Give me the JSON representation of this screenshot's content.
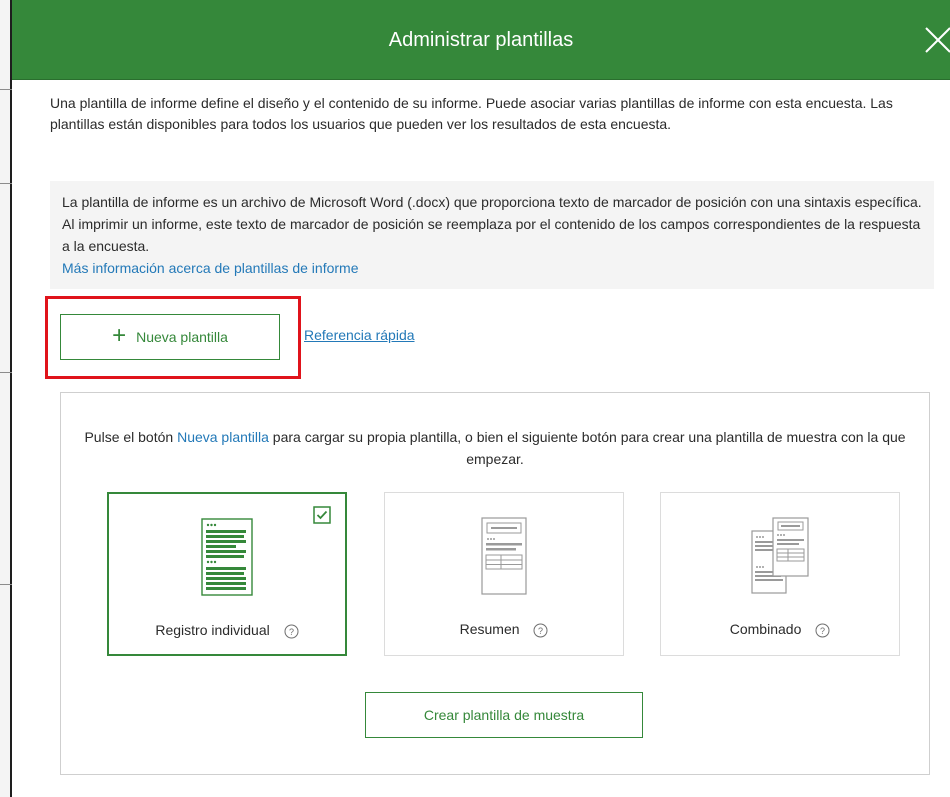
{
  "dialog": {
    "title": "Administrar plantillas",
    "intro": "Una plantilla de informe define el diseño y el contenido de su informe. Puede asociar varias plantillas de informe con esta encuesta. Las plantillas están disponibles para todos los usuarios que pueden ver los resultados de esta encuesta.",
    "info_text": "La plantilla de informe es un archivo de Microsoft Word (.docx) que proporciona texto de marcador de posición con una sintaxis específica. Al imprimir un informe, este texto de marcador de posición se reemplaza por el contenido de los campos correspondientes de la respuesta a la encuesta.",
    "info_link": "Más información acerca de plantillas de informe"
  },
  "actions": {
    "new_template_label": "Nueva plantilla",
    "new_template_icon": "plus-icon",
    "quick_reference_label": "Referencia rápida"
  },
  "samples": {
    "instruction_before": "Pulse el botón ",
    "instruction_link": "Nueva plantilla",
    "instruction_after": " para cargar su propia plantilla, o bien el siguiente botón para crear una plantilla de muestra con la que empezar.",
    "cards": [
      {
        "label": "Registro individual",
        "icon": "individual-record-icon",
        "selected": true
      },
      {
        "label": "Resumen",
        "icon": "summary-icon",
        "selected": false
      },
      {
        "label": "Combinado",
        "icon": "combined-icon",
        "selected": false
      }
    ],
    "create_button_label": "Crear plantilla de muestra"
  },
  "colors": {
    "header_green": "#35883a",
    "link_blue": "#2379b8",
    "highlight_red": "#e0131b"
  }
}
